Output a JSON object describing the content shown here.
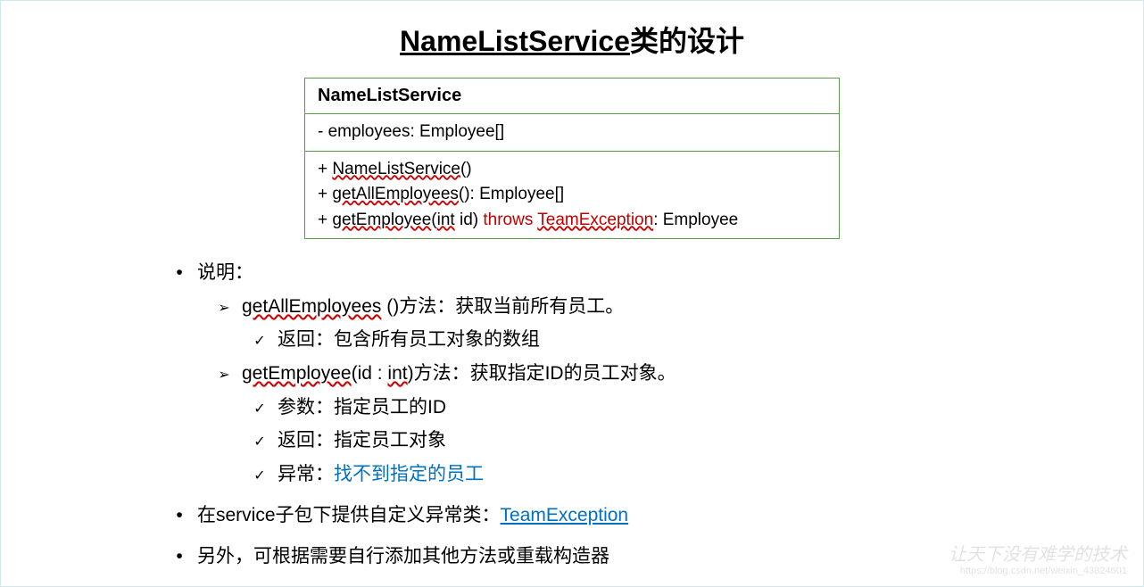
{
  "title": {
    "underlined": "NameListService",
    "rest": "类的设计"
  },
  "uml": {
    "name": "NameListService",
    "attributes": "- employees: Employee[]",
    "methods": {
      "line1_prefix": "+ ",
      "line1_name": "NameListService",
      "line1_suffix": "()",
      "line2_prefix": "+ ",
      "line2_name": "getAllEmployees",
      "line2_suffix": "(): Employee[]",
      "line3_prefix": "+ ",
      "line3_name": "getEmployee",
      "line3_mid": "(",
      "line3_param": "int",
      "line3_mid2": " id) ",
      "line3_throws": "throws",
      "line3_space": " ",
      "line3_exception": "TeamException",
      "line3_suffix": ": Employee"
    }
  },
  "bullets": {
    "explain": "说明：",
    "m1_name": "getAllEmployees",
    "m1_rest": " ()方法：获取当前所有员工。",
    "m1_return": "返回：包含所有员工对象的数组",
    "m2_name": "getEmployee",
    "m2_mid": "(id : ",
    "m2_param": "int",
    "m2_rest": ")方法：获取指定ID的员工对象。",
    "m2_param_desc": "参数：指定员工的ID",
    "m2_return": "返回：指定员工对象",
    "m2_exc_prefix": "异常：",
    "m2_exc_text": "找不到指定的员工",
    "service_prefix": "在service子包下提供自定义异常类：",
    "service_link": "TeamException",
    "extra": "另外，可根据需要自行添加其他方法或重载构造器"
  },
  "watermark": {
    "line1": "让天下没有难学的技术",
    "line2": "https://blog.csdn.net/weixin_43824601"
  }
}
